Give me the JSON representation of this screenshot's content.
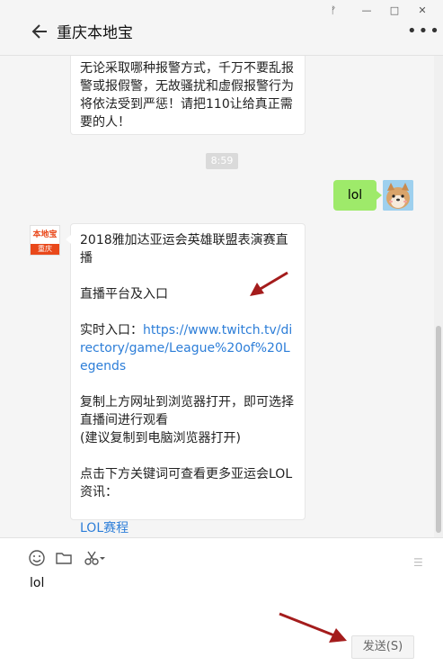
{
  "window": {
    "controls": [
      "ᚠ",
      "—",
      "□",
      "✕"
    ]
  },
  "header": {
    "title": "重庆本地宝",
    "more": "•••"
  },
  "messages": {
    "first_text": "无论采取哪种报警方式，千万不要乱报警或报假警，无故骚扰和虚假报警行为将依法受到严惩！请把110让给真正需要的人！",
    "time": "8:59",
    "my_message": "lol",
    "article": {
      "title": "2018雅加达亚运会英雄联盟表演赛直播",
      "platform": "直播平台及入口",
      "entry_label": "实时入口：",
      "entry_link": "https://www.twitch.tv/directory/game/League%20of%20Legends",
      "copy_tip": "复制上方网址到浏览器打开，即可选择直播间进行观看",
      "copy_tip2": "(建议复制到电脑浏览器打开)",
      "more_tip": "点击下方关键词可查看更多亚运会LOL资讯：",
      "keyword": "LOL赛程"
    }
  },
  "avatar_official": {
    "top": "本地宝",
    "bottom": "重庆"
  },
  "composer": {
    "input_value": "lol",
    "send_label": "发送(S)"
  },
  "colors": {
    "accent_green": "#9eea6a",
    "link": "#2d7ed8",
    "brand_orange": "#e9481a"
  }
}
